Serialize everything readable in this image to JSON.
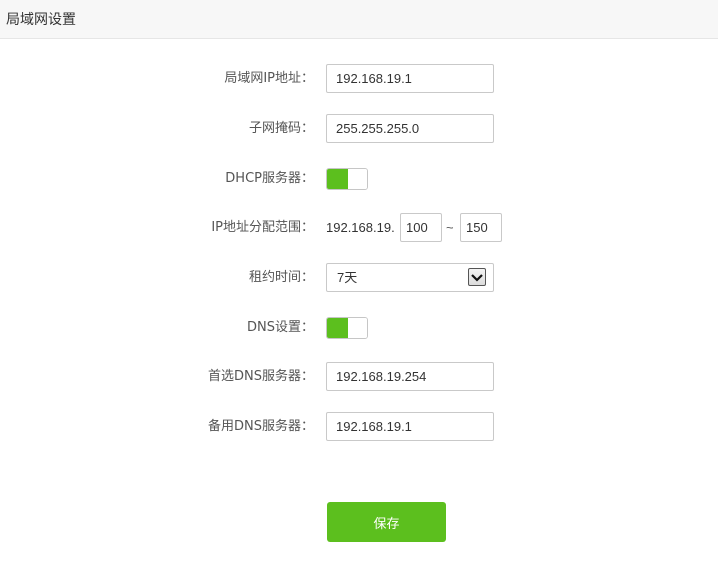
{
  "header": {
    "title": "局域网设置"
  },
  "form": {
    "lan_ip": {
      "label": "局域网IP地址：",
      "value": "192.168.19.1"
    },
    "subnet_mask": {
      "label": "子网掩码：",
      "value": "255.255.255.0"
    },
    "dhcp_server": {
      "label": "DHCP服务器：",
      "enabled": true
    },
    "ip_range": {
      "label": "IP地址分配范围：",
      "prefix": "192.168.19.",
      "start": "100",
      "separator": "~",
      "end": "150"
    },
    "lease_time": {
      "label": "租约时间：",
      "value": "7天"
    },
    "dns_settings": {
      "label": "DNS设置：",
      "enabled": true
    },
    "primary_dns": {
      "label": "首选DNS服务器：",
      "value": "192.168.19.254"
    },
    "secondary_dns": {
      "label": "备用DNS服务器：",
      "value": "192.168.19.1"
    }
  },
  "actions": {
    "save_label": "保存"
  },
  "colors": {
    "accent": "#5cbf1e",
    "header_bg": "#f7f7f7"
  }
}
